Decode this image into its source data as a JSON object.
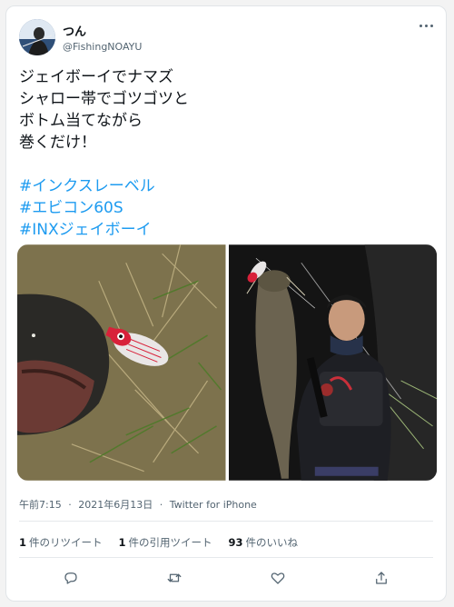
{
  "user": {
    "display_name": "つん",
    "handle": "@FishingNOAYU"
  },
  "tweet": {
    "lines": [
      "ジェイボーイでナマズ",
      "シャロー帯でゴツゴツと",
      "ボトム当てながら",
      "巻くだけ！"
    ],
    "hashtags": [
      "#インクスレーベル",
      "#エビコン60S",
      "#INXジェイボーイ"
    ]
  },
  "meta": {
    "time": "午前7:15",
    "separator": "·",
    "date": "2021年6月13日",
    "source": "Twitter for iPhone"
  },
  "stats": {
    "retweets_count": "1",
    "retweets_label": "件のリツイート",
    "quotes_count": "1",
    "quotes_label": "件の引用ツイート",
    "likes_count": "93",
    "likes_label": "件のいいね"
  },
  "icons": {
    "more": "more-dots-icon",
    "reply": "reply-icon",
    "retweet": "retweet-icon",
    "like": "heart-icon",
    "share": "share-icon"
  },
  "colors": {
    "link": "#1d9bf0",
    "secondary_text": "#536471",
    "lure_red": "#d8213a"
  }
}
